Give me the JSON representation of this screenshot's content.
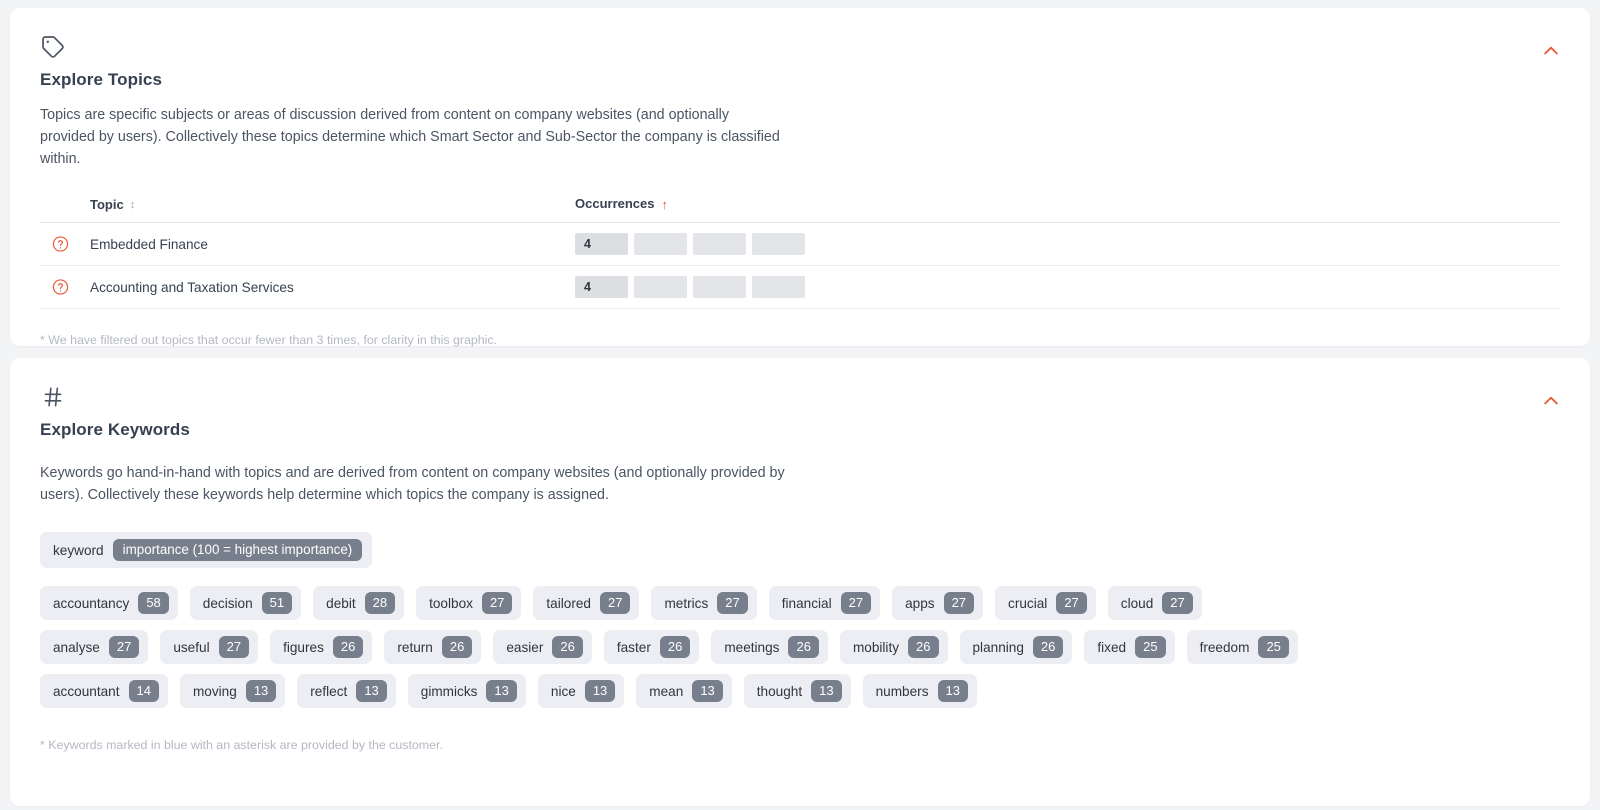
{
  "topics_section": {
    "icon": "tag-icon",
    "title": "Explore Topics",
    "description": "Topics are specific subjects or areas of discussion derived from content on company websites (and optionally provided by users). Collectively these topics determine which Smart Sector and Sub-Sector the company is classified within.",
    "collapse_icon": "chevron-up-icon",
    "table": {
      "columns": [
        "Topic",
        "Occurrences"
      ],
      "sort_column": "Occurrences",
      "sort_direction": "ascending",
      "sort_arrow_glyph": "↑",
      "sort_toggle_glyph": "↕",
      "max_segments": 4,
      "rows": [
        {
          "topic": "Embedded Finance",
          "occurrences": 4,
          "filled_segments": 1,
          "help_icon": "help-circle-icon"
        },
        {
          "topic": "Accounting and Taxation Services",
          "occurrences": 4,
          "filled_segments": 1,
          "help_icon": "help-circle-icon"
        }
      ]
    },
    "footnote": "* We have filtered out topics that occur fewer than 3 times, for clarity in this graphic."
  },
  "keywords_section": {
    "icon": "hash-icon",
    "title": "Explore Keywords",
    "description": "Keywords go hand-in-hand with topics and are derived from content on company websites (and optionally provided by users). Collectively these keywords help determine which topics the company is assigned.",
    "collapse_icon": "chevron-up-icon",
    "legend": {
      "label": "keyword",
      "badge": "importance (100 = highest importance)"
    },
    "rows": [
      [
        {
          "keyword": "accountancy",
          "score": 58
        },
        {
          "keyword": "decision",
          "score": 51
        },
        {
          "keyword": "debit",
          "score": 28
        },
        {
          "keyword": "toolbox",
          "score": 27
        },
        {
          "keyword": "tailored",
          "score": 27
        },
        {
          "keyword": "metrics",
          "score": 27
        },
        {
          "keyword": "financial",
          "score": 27
        },
        {
          "keyword": "apps",
          "score": 27
        },
        {
          "keyword": "crucial",
          "score": 27
        },
        {
          "keyword": "cloud",
          "score": 27
        }
      ],
      [
        {
          "keyword": "analyse",
          "score": 27
        },
        {
          "keyword": "useful",
          "score": 27
        },
        {
          "keyword": "figures",
          "score": 26
        },
        {
          "keyword": "return",
          "score": 26
        },
        {
          "keyword": "easier",
          "score": 26
        },
        {
          "keyword": "faster",
          "score": 26
        },
        {
          "keyword": "meetings",
          "score": 26
        },
        {
          "keyword": "mobility",
          "score": 26
        },
        {
          "keyword": "planning",
          "score": 26
        },
        {
          "keyword": "fixed",
          "score": 25
        },
        {
          "keyword": "freedom",
          "score": 25
        }
      ],
      [
        {
          "keyword": "accountant",
          "score": 14
        },
        {
          "keyword": "moving",
          "score": 13
        },
        {
          "keyword": "reflect",
          "score": 13
        },
        {
          "keyword": "gimmicks",
          "score": 13
        },
        {
          "keyword": "nice",
          "score": 13
        },
        {
          "keyword": "mean",
          "score": 13
        },
        {
          "keyword": "thought",
          "score": 13
        },
        {
          "keyword": "numbers",
          "score": 13
        }
      ]
    ],
    "footnote": "* Keywords marked in blue with an asterisk are provided by the customer."
  },
  "colors": {
    "accent": "#e8593a",
    "chip_bg": "#eceef3",
    "badge_bg": "#777e8c",
    "page_bg": "#f3f4f6",
    "card_bg": "#ffffff",
    "text": "#374151",
    "muted": "#b4b8c2"
  }
}
